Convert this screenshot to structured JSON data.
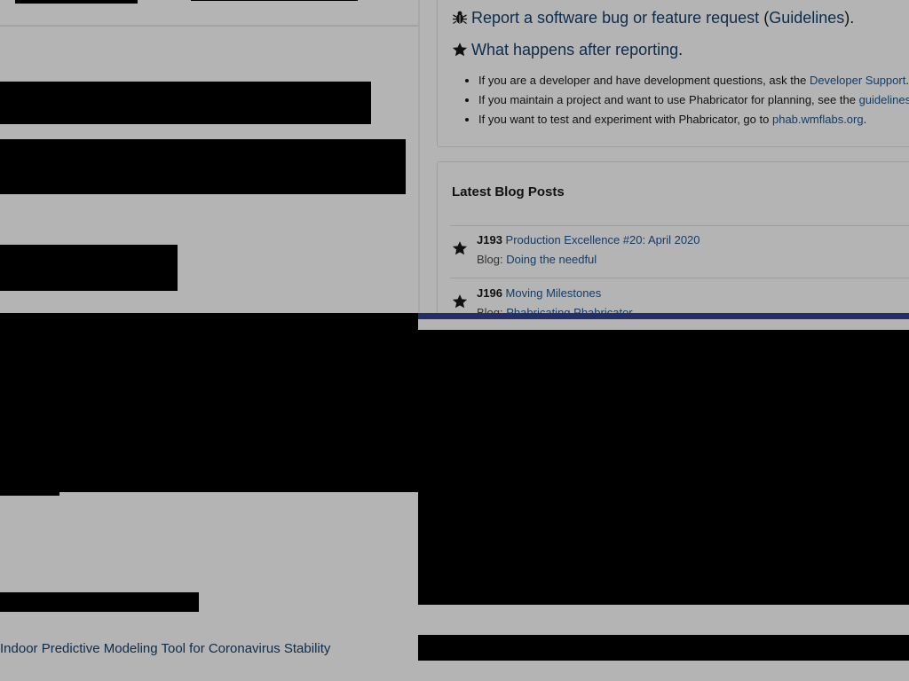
{
  "report": {
    "link_text": "Report a software bug or feature request",
    "open_paren": "(",
    "guidelines_text": "Guidelines",
    "close_paren": ")."
  },
  "after_reporting": {
    "link_text": "What happens after reporting",
    "suffix": "."
  },
  "help_bullets": [
    {
      "prefix": "If you are a developer and have development questions, ask the",
      "link": "Developer Support",
      "suffix": "."
    },
    {
      "prefix": "If you maintain a project and want to use Phabricator for planning, see the",
      "link": "guidelines",
      "suffix": "."
    },
    {
      "prefix": "If you want to test and experiment with Phabricator, go to",
      "link": "phab.wmflabs.org",
      "suffix": "."
    }
  ],
  "blog": {
    "title": "Latest Blog Posts",
    "meta_label": "Blog:",
    "posts": [
      {
        "id": "J193",
        "title": "Production Excellence #20: April 2020",
        "blog": "Doing the needful"
      },
      {
        "id": "J196",
        "title": "Moving Milestones",
        "blog": "Phabricating Phabricator"
      }
    ]
  },
  "footer": {
    "link_text": "Indoor Predictive Modeling Tool for Coronavirus Stability"
  },
  "icons": {
    "bug": "bug-icon",
    "star": "star-icon"
  },
  "colors": {
    "background": "#b4b4b4",
    "link": "#163c63",
    "accent_bar": "#262e6a",
    "redaction": "#000000"
  }
}
